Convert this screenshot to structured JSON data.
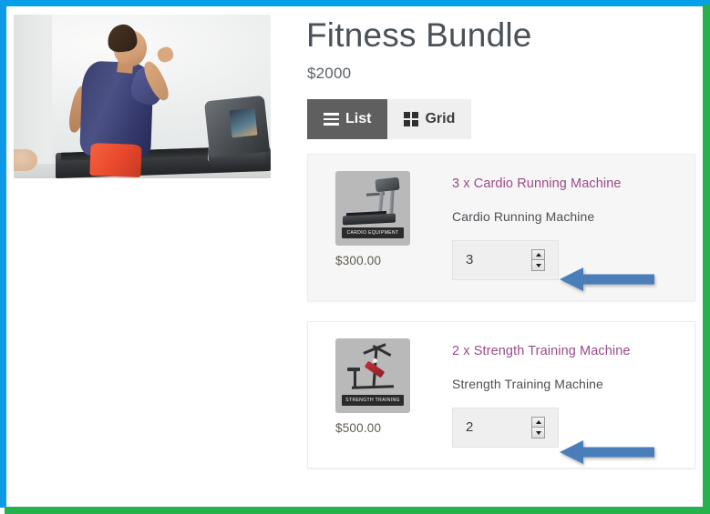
{
  "annotation": {
    "border_top_color": "#06a0e8",
    "border_left_color": "#0d9ae6",
    "border_right_color": "#23b24b",
    "border_bottom_color": "#23b24b",
    "arrow_color": "#4a7ebb",
    "arrows": [
      {
        "name": "arrow-pointing-to-quantity-1",
        "direction": "left"
      },
      {
        "name": "arrow-pointing-to-quantity-2",
        "direction": "left"
      }
    ]
  },
  "hero": {
    "alt": "Man running on a treadmill",
    "photo_description": "Man in navy blue t-shirt and orange shorts running on a black treadmill against a light gray background"
  },
  "product": {
    "title": "Fitness Bundle",
    "price": "$2000",
    "title_color": "#4a5158",
    "price_color": "#5b6267"
  },
  "view_tabs": [
    {
      "label": "List",
      "icon": "list-icon",
      "active": true
    },
    {
      "label": "Grid",
      "icon": "grid-icon",
      "active": false
    }
  ],
  "bundle_items": [
    {
      "link_label": "3 x Cardio Running Machine",
      "name": "Cardio Running Machine",
      "price": "$300.00",
      "quantity": "3",
      "thumb_badge": "CARDIO EQUIPMENT",
      "thumb_alt": "Treadmill",
      "link_color": "#9b4a8a",
      "row_background": "#f6f6f6"
    },
    {
      "link_label": "2 x Strength Training Machine",
      "name": "Strength Training Machine",
      "price": "$500.00",
      "quantity": "2",
      "thumb_badge": "STRENGTH TRAINING",
      "thumb_alt": "Strength training home gym machine",
      "link_color": "#9b4a8a",
      "row_background": "#ffffff"
    }
  ]
}
